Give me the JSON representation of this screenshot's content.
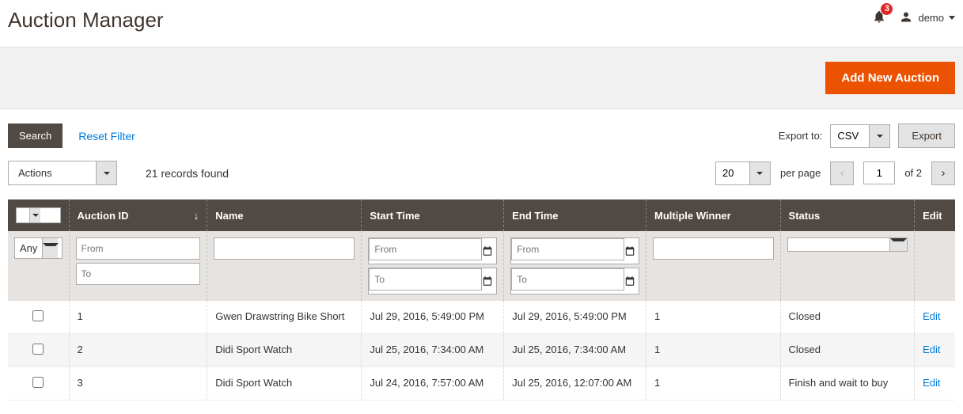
{
  "header": {
    "title": "Auction Manager",
    "notification_count": "3",
    "username": "demo"
  },
  "actions": {
    "add_new": "Add New Auction"
  },
  "toolbar": {
    "search": "Search",
    "reset_filter": "Reset Filter",
    "export_to": "Export to:",
    "export_format": "CSV",
    "export_btn": "Export",
    "actions_label": "Actions",
    "records_found": "21 records found",
    "per_page_value": "20",
    "per_page_label": "per page",
    "page_value": "1",
    "page_total": "of 2"
  },
  "columns": {
    "auction_id": "Auction ID",
    "name": "Name",
    "start_time": "Start Time",
    "end_time": "End Time",
    "multiple_winner": "Multiple Winner",
    "status": "Status",
    "edit": "Edit"
  },
  "filters": {
    "any": "Any",
    "from": "From",
    "to": "To"
  },
  "rows": [
    {
      "id": "1",
      "name": "Gwen Drawstring Bike Short",
      "start": "Jul 29, 2016, 5:49:00 PM",
      "end": "Jul 29, 2016, 5:49:00 PM",
      "mw": "1",
      "status": "Closed",
      "edit": "Edit"
    },
    {
      "id": "2",
      "name": "Didi Sport Watch",
      "start": "Jul 25, 2016, 7:34:00 AM",
      "end": "Jul 25, 2016, 7:34:00 AM",
      "mw": "1",
      "status": "Closed",
      "edit": "Edit"
    },
    {
      "id": "3",
      "name": "Didi Sport Watch",
      "start": "Jul 24, 2016, 7:57:00 AM",
      "end": "Jul 25, 2016, 12:07:00 AM",
      "mw": "1",
      "status": "Finish and wait to buy",
      "edit": "Edit"
    }
  ]
}
